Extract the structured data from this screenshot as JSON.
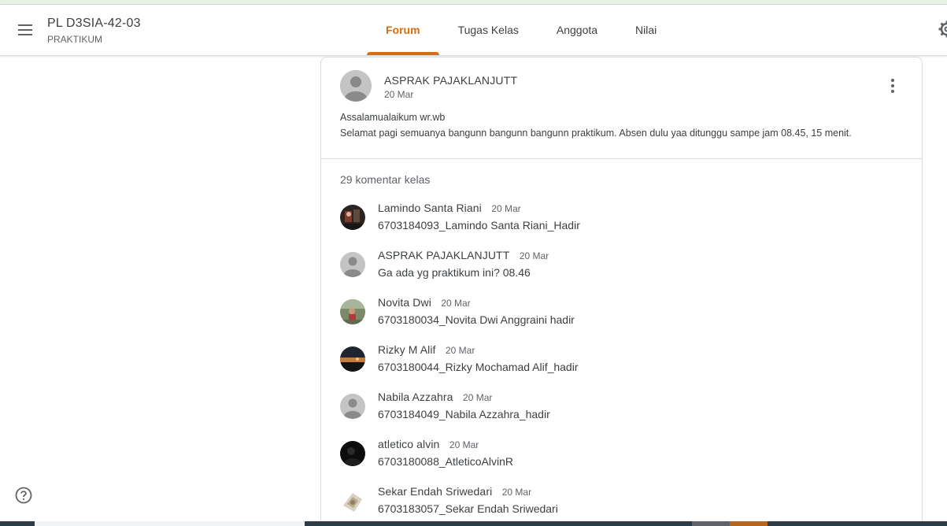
{
  "header": {
    "class_name": "PL D3SIA-42-03",
    "class_section": "PRAKTIKUM",
    "tabs": [
      {
        "label": "Forum",
        "active": true
      },
      {
        "label": "Tugas Kelas",
        "active": false
      },
      {
        "label": "Anggota",
        "active": false
      },
      {
        "label": "Nilai",
        "active": false
      }
    ]
  },
  "post": {
    "author": "ASPRAK PAJAKLANJUTT",
    "date": "20 Mar",
    "body_line1": "Assalamualaikum wr.wb",
    "body_line2": "Selamat pagi semuanya bangunn bangunn bangunn praktikum. Absen dulu yaa ditunggu sampe jam 08.45, 15 menit."
  },
  "comments_header": "29 komentar kelas",
  "comments": [
    {
      "name": "Lamindo Santa Riani",
      "date": "20 Mar",
      "text": "6703184093_Lamindo Santa Riani_Hadir",
      "avatar": "photo-dark-icon"
    },
    {
      "name": "ASPRAK PAJAKLANJUTT",
      "date": "20 Mar",
      "text": "Ga ada yg praktikum ini? 08.46",
      "avatar": "default-person-icon"
    },
    {
      "name": "Novita Dwi",
      "date": "20 Mar",
      "text": "6703180034_Novita Dwi Anggraini hadir",
      "avatar": "photo-outdoor-icon"
    },
    {
      "name": "Rizky M Alif",
      "date": "20 Mar",
      "text": "6703180044_Rizky Mochamad Alif_hadir",
      "avatar": "photo-sunset-icon"
    },
    {
      "name": "Nabila Azzahra",
      "date": "20 Mar",
      "text": "6703184049_Nabila Azzahra_hadir",
      "avatar": "default-person-icon"
    },
    {
      "name": "atletico alvin",
      "date": "20 Mar",
      "text": "6703180088_AtleticoAlvinR",
      "avatar": "photo-black-icon"
    },
    {
      "name": "Sekar Endah Sriwedari",
      "date": "20 Mar",
      "text": "6703183057_Sekar Endah Sriwedari",
      "avatar": "photo-light-icon"
    }
  ],
  "colors": {
    "accent": "#d56e0c",
    "text": "#3c4043",
    "muted": "#5f6368",
    "border": "#dadce0"
  }
}
